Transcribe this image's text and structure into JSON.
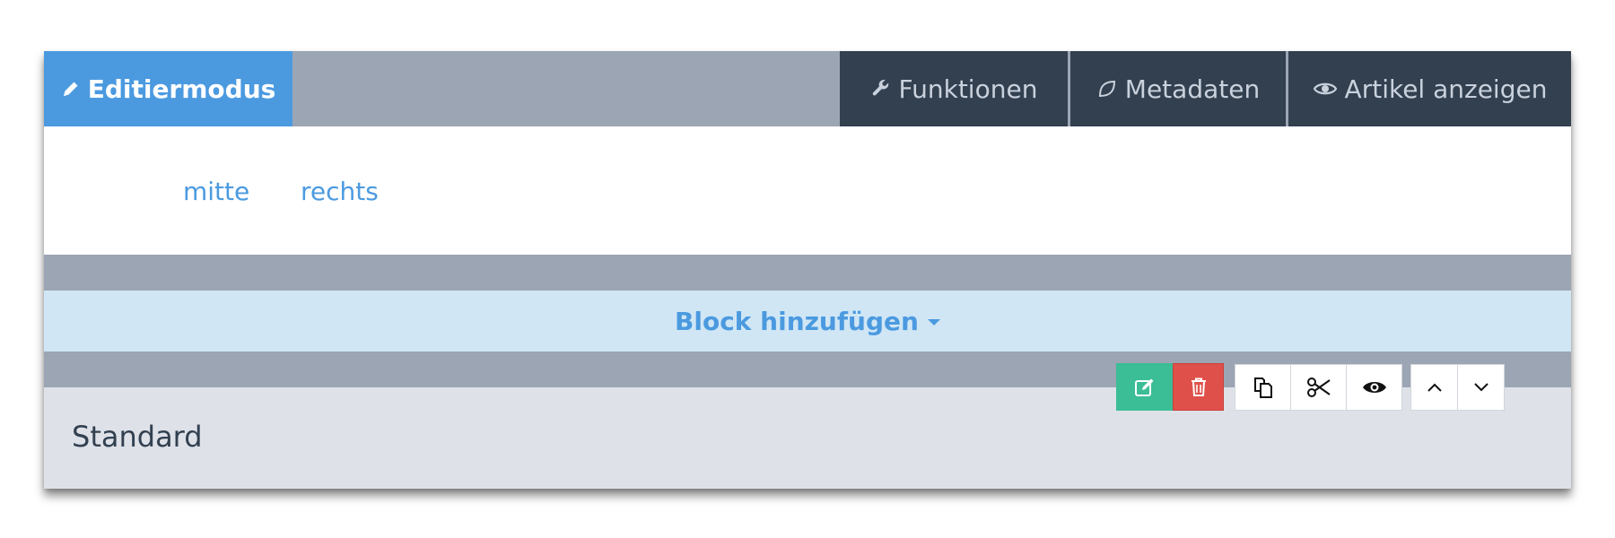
{
  "tabs": {
    "edit_mode": "Editiermodus",
    "functions": "Funktionen",
    "metadata": "Metadaten",
    "view_article": "Artikel anzeigen"
  },
  "slice_nav": {
    "links": [
      "mitte",
      "rechts"
    ]
  },
  "add_block": {
    "label": "Block hinzufügen"
  },
  "slice": {
    "title": "Standard"
  },
  "icons": {
    "edit_mode": "pencil-icon",
    "functions": "wrench-icon",
    "metadata": "leaf-icon",
    "view_article": "eye-icon",
    "slice_edit": "edit-icon",
    "slice_delete": "trash-icon",
    "slice_copy": "copy-icon",
    "slice_cut": "scissors-icon",
    "slice_view": "eye-icon",
    "move_up": "chevron-up-icon",
    "move_down": "chevron-down-icon"
  },
  "colors": {
    "accent": "#4b9ae0",
    "dark_tab": "#324050",
    "gray_band": "#9ca5b3",
    "add_block_bg": "#d0e6f5",
    "slice_bg": "#dee1e8",
    "edit_green": "#3bbd96",
    "delete_red": "#e0504a"
  }
}
